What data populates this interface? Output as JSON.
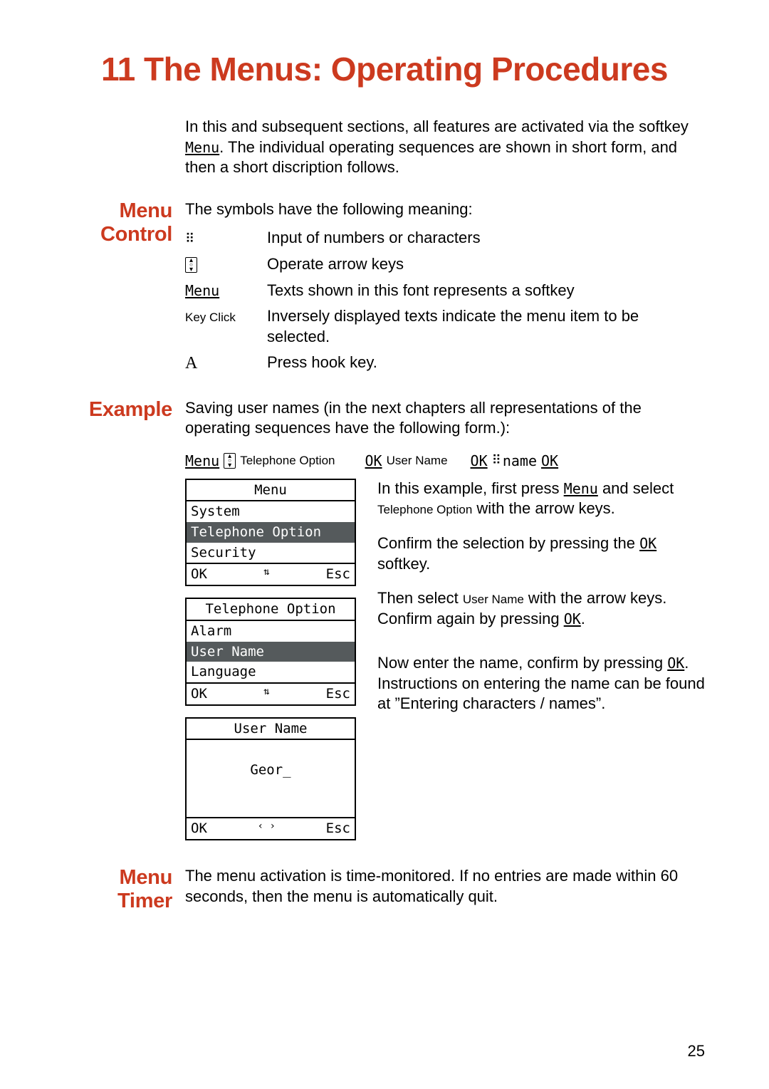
{
  "chapter": {
    "number": "11",
    "title": "The Menus: Operating Procedures"
  },
  "intro": {
    "text_a": "In this and subsequent sections, all features are activated via the softkey ",
    "softkey": "Menu",
    "text_b": ". The individual operating sequences are shown in short form, and then a short discription follows."
  },
  "menu_control": {
    "heading": "Menu Control",
    "lead": "The symbols have the following meaning:",
    "rows": [
      {
        "sym_type": "keypad",
        "desc": "Input of numbers or characters"
      },
      {
        "sym_type": "arrowbox",
        "desc": "Operate arrow keys"
      },
      {
        "sym_type": "softkey",
        "sym_text": "Menu",
        "desc": "Texts shown in this font represents a softkey"
      },
      {
        "sym_type": "inverse",
        "sym_text": "Key Click",
        "desc": "Inversely displayed texts indicate the menu item to be selected."
      },
      {
        "sym_type": "hook",
        "sym_text": "A",
        "desc": "Press hook key."
      }
    ]
  },
  "example": {
    "heading": "Example",
    "lead": "Saving user names (in the next chapters all representations of the operating sequences have the following form.):",
    "seq": {
      "s1": "Menu",
      "m1": "Telephone Option",
      "s2": "OK",
      "m2": "User Name",
      "s3": "OK",
      "t3": "name",
      "s4": "OK"
    },
    "desc": {
      "p1a": "In this example, first press ",
      "p1_sk": "Menu",
      "p1b": " and select ",
      "p1_mi": "Telephone Option",
      "p1c": " with the arrow keys.",
      "p2a": "Confirm the selection by pressing the ",
      "p2_sk": "OK",
      "p2b": " softkey.",
      "p3a": "Then select ",
      "p3_mi": "User Name",
      "p3b": " with the arrow keys. Confirm again by pressing ",
      "p3_sk": "OK",
      "p3c": ".",
      "p4a": "Now enter the name, confirm by pressing ",
      "p4_sk": "OK",
      "p4b": ". Instructions on entering the name can be found at ”Entering characters / names”."
    },
    "screens": [
      {
        "title": "Menu",
        "items": [
          "System",
          "Telephone Option",
          "Security"
        ],
        "selected": 1,
        "foot_l": "OK",
        "foot_m": "⇅",
        "foot_r": "Esc"
      },
      {
        "title": "Telephone Option",
        "items": [
          "Alarm",
          "User Name",
          "Language"
        ],
        "selected": 1,
        "foot_l": "OK",
        "foot_m": "⇅",
        "foot_r": "Esc"
      },
      {
        "title": "User Name",
        "body": "Geor_",
        "foot_l": "OK",
        "foot_m": "‹ ›",
        "foot_r": "Esc"
      }
    ]
  },
  "menu_timer": {
    "heading": "Menu Timer",
    "text": "The menu activation is time-monitored. If no entries are made within 60 seconds, then the menu is automatically quit."
  },
  "page_number": "25"
}
